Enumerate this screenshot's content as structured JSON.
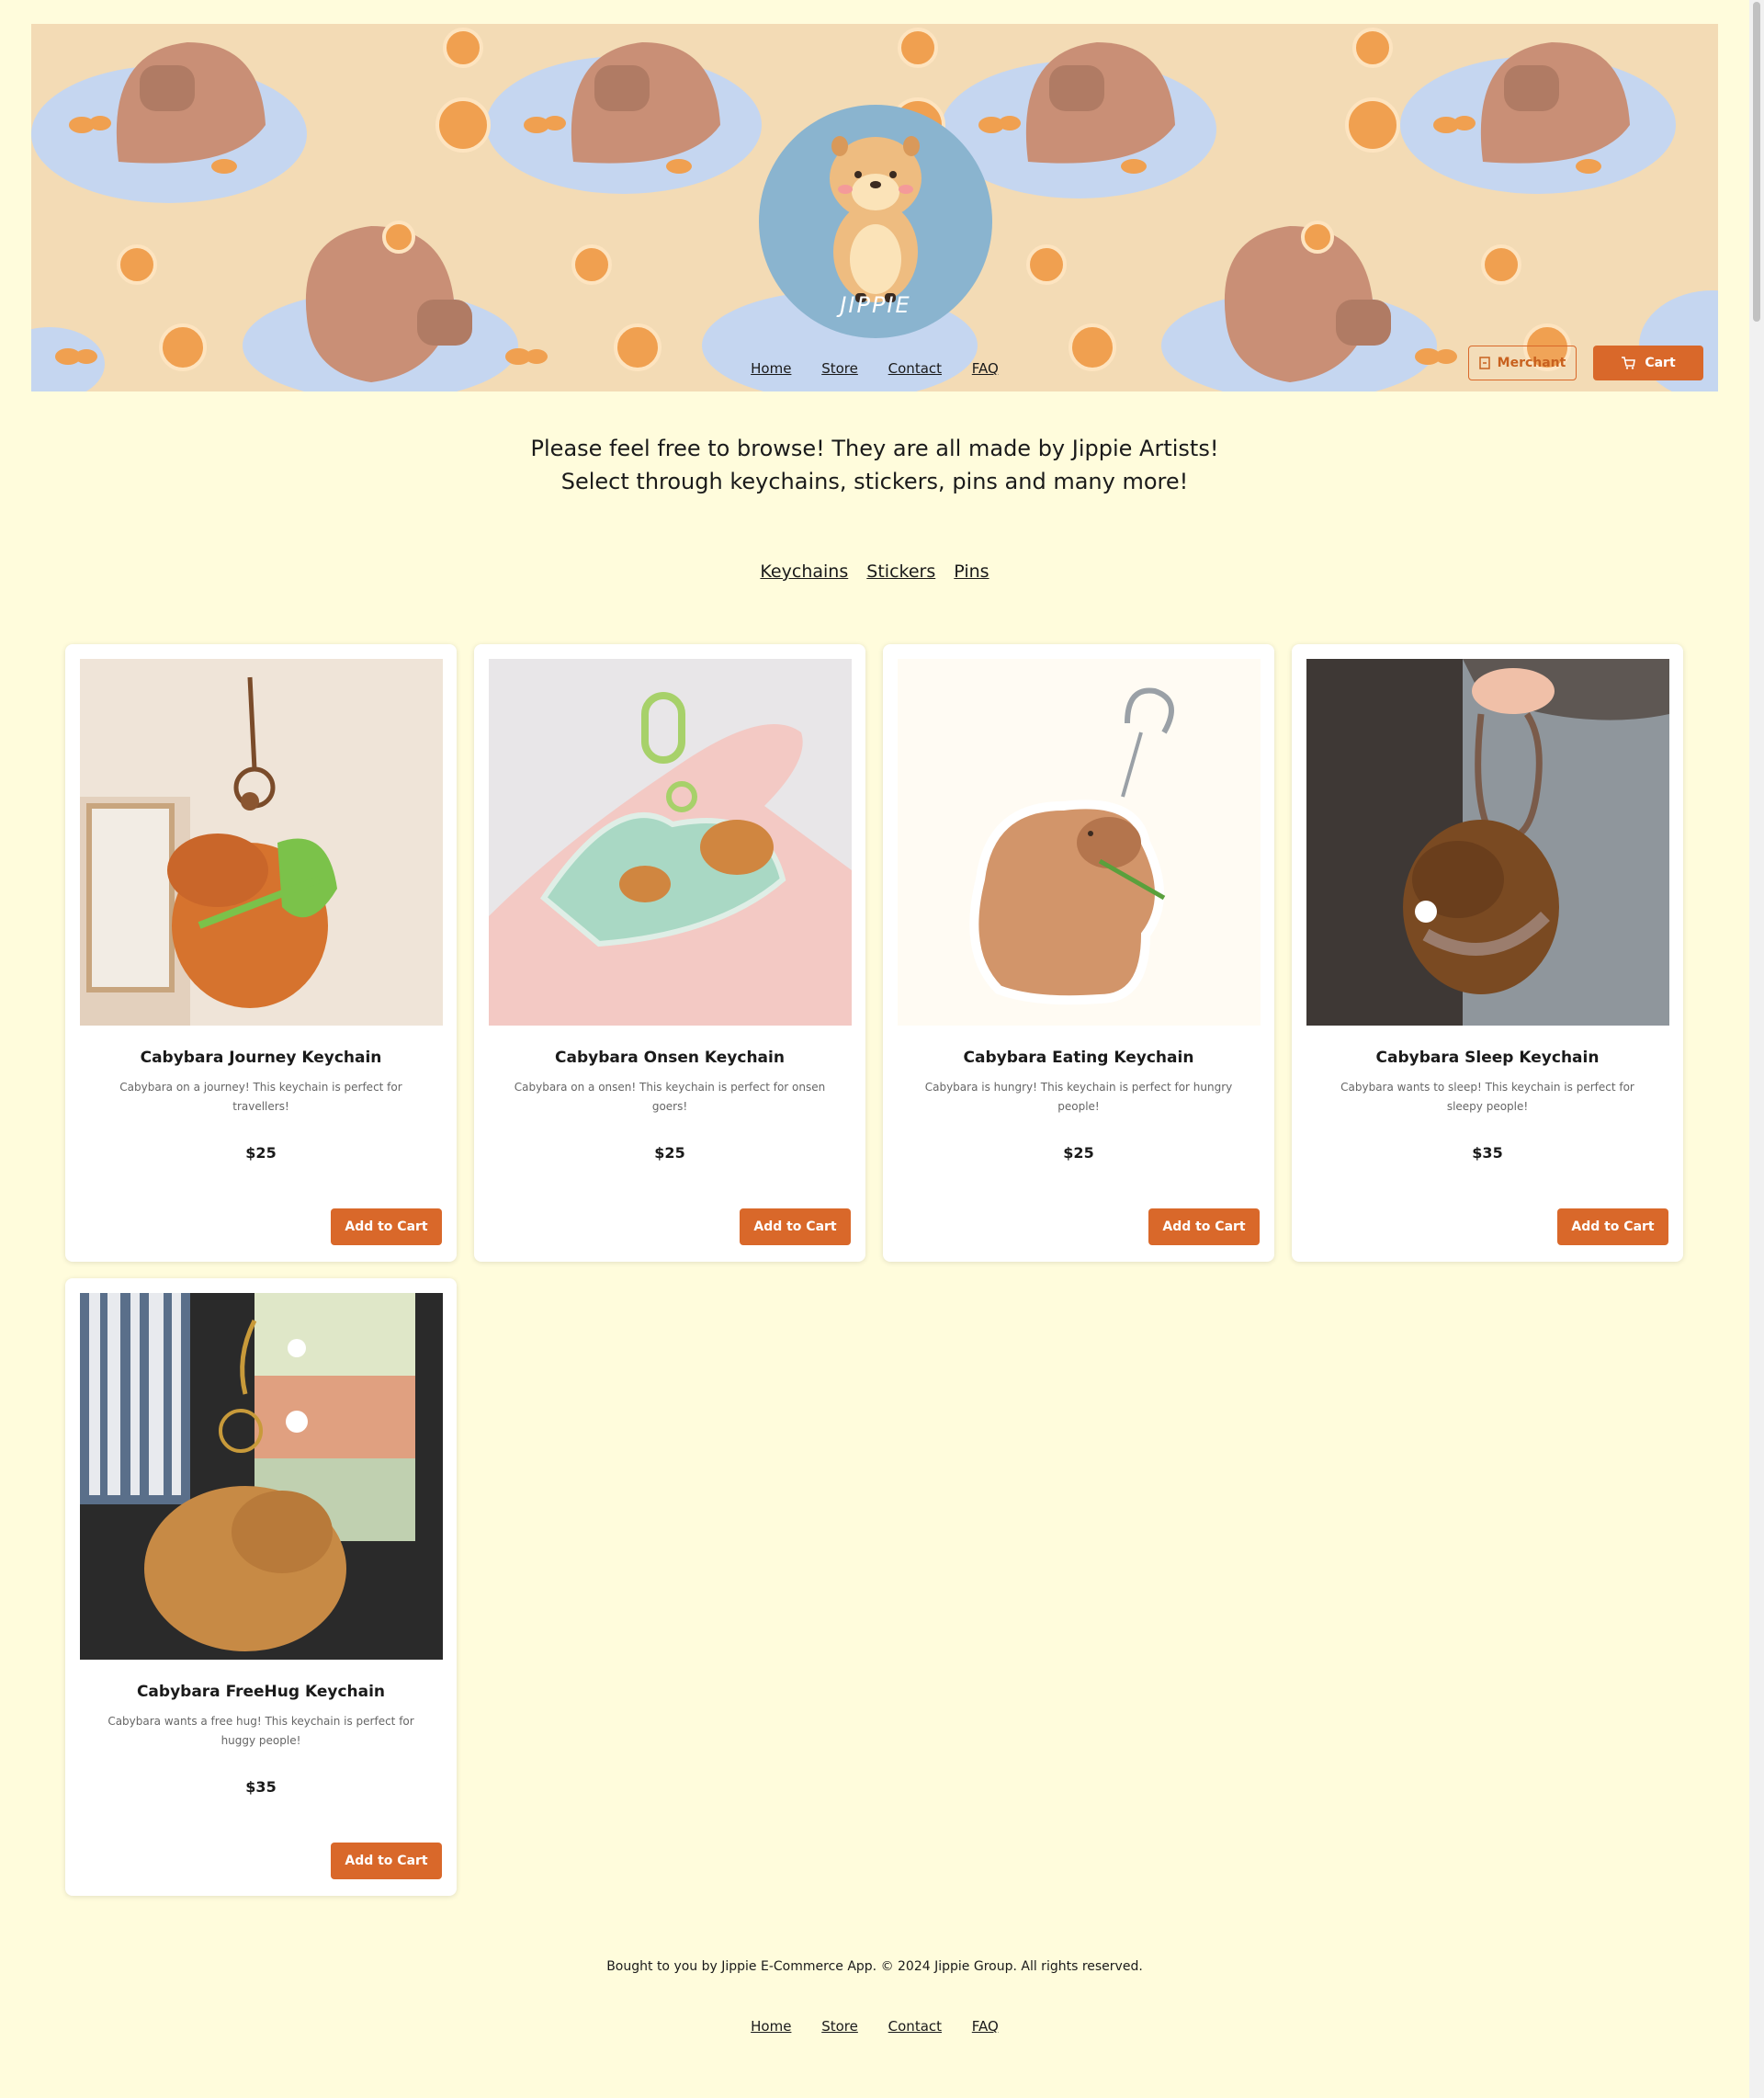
{
  "brand": {
    "logo_text": "JIPPIE"
  },
  "nav": {
    "home": "Home",
    "store": "Store",
    "contact": "Contact",
    "faq": "FAQ"
  },
  "header_actions": {
    "merchant": "Merchant",
    "cart": "Cart"
  },
  "intro": {
    "line1": "Please feel free to browse! They are all made by Jippie Artists!",
    "line2": "Select through keychains, stickers, pins and many more!"
  },
  "categories": [
    "Keychains",
    "Stickers",
    "Pins"
  ],
  "products": [
    {
      "name": "Cabybara Journey Keychain",
      "desc": "Cabybara on a journey! This keychain is perfect for travellers!",
      "price": "$25",
      "button": "Add to Cart"
    },
    {
      "name": "Cabybara Onsen Keychain",
      "desc": "Cabybara on a onsen! This keychain is perfect for onsen goers!",
      "price": "$25",
      "button": "Add to Cart"
    },
    {
      "name": "Cabybara Eating Keychain",
      "desc": "Cabybara is hungry! This keychain is perfect for hungry people!",
      "price": "$25",
      "button": "Add to Cart"
    },
    {
      "name": "Cabybara Sleep Keychain",
      "desc": "Cabybara wants to sleep! This keychain is perfect for sleepy people!",
      "price": "$35",
      "button": "Add to Cart"
    },
    {
      "name": "Cabybara FreeHug Keychain",
      "desc": "Cabybara wants a free hug! This keychain is perfect for huggy people!",
      "price": "$35",
      "button": "Add to Cart"
    }
  ],
  "footer": {
    "text": "Bought to you by Jippie E-Commerce App. © 2024 Jippie Group. All rights reserved.",
    "home": "Home",
    "store": "Store",
    "contact": "Contact",
    "faq": "FAQ"
  },
  "colors": {
    "background": "#fffcdc",
    "accent": "#d9682a",
    "banner": "#f3dbb5"
  }
}
